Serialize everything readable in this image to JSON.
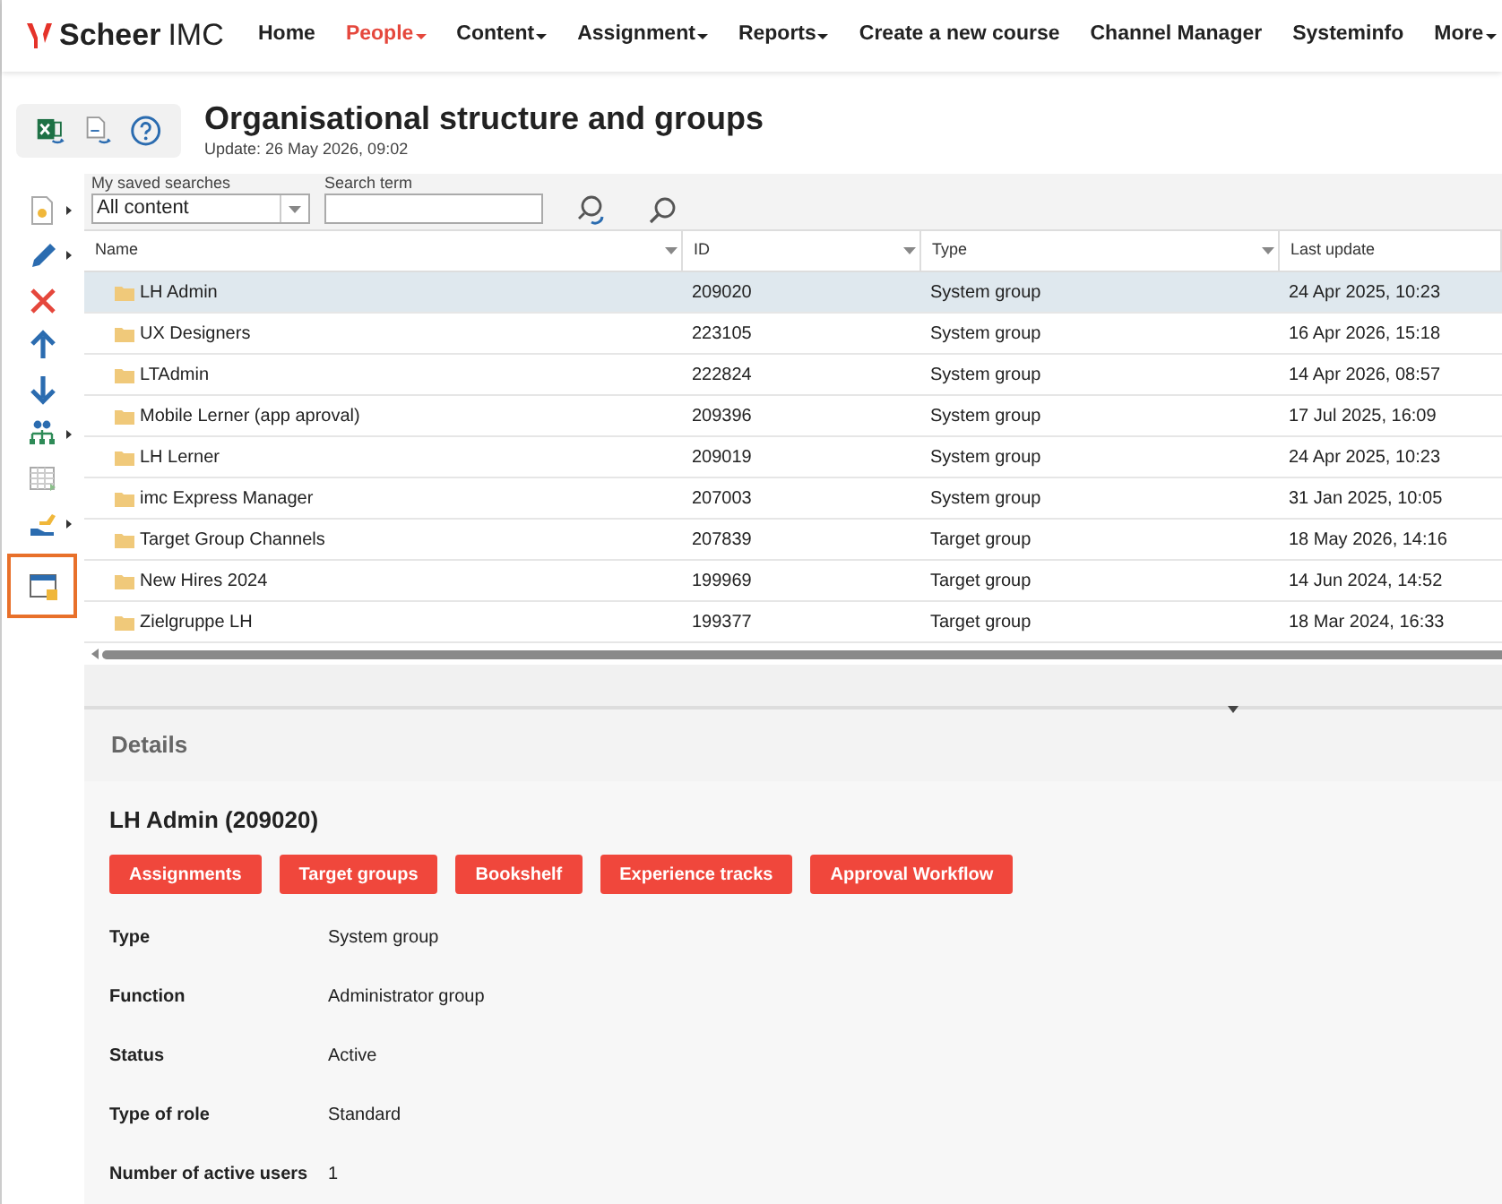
{
  "brand": {
    "name": "Scheer",
    "suffix": "IMC"
  },
  "nav": [
    {
      "label": "Home",
      "selected": false,
      "has_menu": false
    },
    {
      "label": "People",
      "selected": true,
      "has_menu": true
    },
    {
      "label": "Content",
      "selected": false,
      "has_menu": true
    },
    {
      "label": "Assignment",
      "selected": false,
      "has_menu": true
    },
    {
      "label": "Reports",
      "selected": false,
      "has_menu": true
    },
    {
      "label": "Create a new course",
      "selected": false,
      "has_menu": false
    },
    {
      "label": "Channel Manager",
      "selected": false,
      "has_menu": false
    },
    {
      "label": "Systeminfo",
      "selected": false,
      "has_menu": false
    },
    {
      "label": "More",
      "selected": false,
      "has_menu": true
    }
  ],
  "page": {
    "title": "Organisational structure and groups",
    "updated": "Update: 26 May 2026, 09:02"
  },
  "toolbar": [
    {
      "kind": "new",
      "selected": false,
      "has_menu": true
    },
    {
      "kind": "edit",
      "selected": false,
      "has_menu": true
    },
    {
      "kind": "delete",
      "selected": false,
      "has_menu": false
    },
    {
      "kind": "up",
      "selected": false,
      "has_menu": false
    },
    {
      "kind": "down",
      "selected": false,
      "has_menu": false
    },
    {
      "kind": "hierarchy",
      "selected": false,
      "has_menu": true
    },
    {
      "kind": "table",
      "selected": false,
      "has_menu": false
    },
    {
      "kind": "hand",
      "selected": false,
      "has_menu": true
    },
    {
      "kind": "window",
      "selected": true,
      "has_menu": false
    }
  ],
  "search": {
    "saved_label": "My saved searches",
    "saved_value": "All content",
    "term_label": "Search term"
  },
  "table": {
    "columns": [
      "Name",
      "ID",
      "Type",
      "Last update"
    ],
    "rows": [
      {
        "name": "LH Admin",
        "id": "209020",
        "type": "System group",
        "updated": "24 Apr 2025, 10:23",
        "selected": true
      },
      {
        "name": "UX Designers",
        "id": "223105",
        "type": "System group",
        "updated": "16 Apr 2026, 15:18",
        "selected": false
      },
      {
        "name": "LTAdmin",
        "id": "222824",
        "type": "System group",
        "updated": "14 Apr 2026, 08:57",
        "selected": false
      },
      {
        "name": "Mobile Lerner (app aproval)",
        "id": "209396",
        "type": "System group",
        "updated": "17 Jul 2025, 16:09",
        "selected": false
      },
      {
        "name": "LH Lerner",
        "id": "209019",
        "type": "System group",
        "updated": "24 Apr 2025, 10:23",
        "selected": false
      },
      {
        "name": "imc Express Manager",
        "id": "207003",
        "type": "System group",
        "updated": "31 Jan 2025, 10:05",
        "selected": false
      },
      {
        "name": "Target Group Channels",
        "id": "207839",
        "type": "Target group",
        "updated": "18 May 2026, 14:16",
        "selected": false
      },
      {
        "name": "New Hires 2024",
        "id": "199969",
        "type": "Target group",
        "updated": "14 Jun 2024, 14:52",
        "selected": false
      },
      {
        "name": "Zielgruppe LH",
        "id": "199377",
        "type": "Target group",
        "updated": "18 Mar 2024, 16:33",
        "selected": false
      }
    ]
  },
  "details": {
    "heading": "Details",
    "title": "LH Admin (209020)",
    "buttons": [
      "Assignments",
      "Target groups",
      "Bookshelf",
      "Experience tracks",
      "Approval Workflow"
    ],
    "fields": [
      {
        "label": "Type",
        "value": "System group"
      },
      {
        "label": "Function",
        "value": "Administrator group"
      },
      {
        "label": "Status",
        "value": "Active"
      },
      {
        "label": "Type of role",
        "value": "Standard"
      },
      {
        "label": "Number of active users",
        "value": "1"
      }
    ]
  }
}
